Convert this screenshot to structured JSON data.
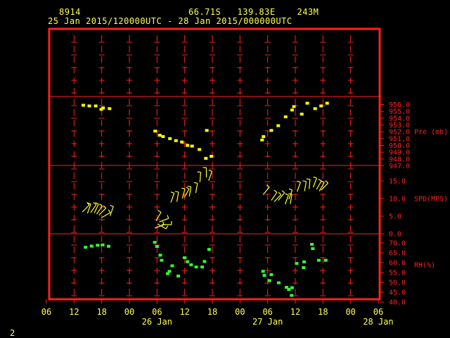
{
  "header": {
    "station": "8914",
    "location": "66.71S   139.83E    243M",
    "period": "25 Jan 2015/120000UTC - 28 Jan 2015/000000UTC"
  },
  "footer_number": "2",
  "colors": {
    "frame": "#ff2020",
    "text": "#ffff4d",
    "pressure": "#ffff00",
    "wind": "#ffff33",
    "rh": "#33ff33"
  },
  "chart_data": {
    "type": "scatter",
    "x_ticks": [
      "06",
      "12",
      "18",
      "00",
      "06",
      "12",
      "18",
      "00",
      "06",
      "12",
      "18",
      "00",
      "06"
    ],
    "date_labels": [
      {
        "label": "26 Jan",
        "hour_index": 4
      },
      {
        "label": "27 Jan",
        "hour_index": 8
      },
      {
        "label": "28 Jan",
        "hour_index": 12
      }
    ],
    "panels": [
      {
        "key": "pressure",
        "label": "Pre (mb)",
        "ticks": [
          "956.0",
          "955.0",
          "954.0",
          "953.0",
          "952.0",
          "951.0",
          "950.0",
          "949.0",
          "948.0",
          "947.0"
        ],
        "ylim": [
          947,
          956
        ],
        "points": [
          [
            14.0,
            955.9
          ],
          [
            15.3,
            955.8
          ],
          [
            16.7,
            955.8
          ],
          [
            17.9,
            955.3
          ],
          [
            18.3,
            955.5
          ],
          [
            19.7,
            955.4
          ],
          [
            29.6,
            952.1
          ],
          [
            30.6,
            951.5
          ],
          [
            31.3,
            951.3
          ],
          [
            32.8,
            951.0
          ],
          [
            34.1,
            950.7
          ],
          [
            35.4,
            950.5
          ],
          [
            36.6,
            950.0
          ],
          [
            37.6,
            949.9
          ],
          [
            39.2,
            949.4
          ],
          [
            40.6,
            948.1
          ],
          [
            40.8,
            952.2
          ],
          [
            41.8,
            948.4
          ],
          [
            52.8,
            950.8
          ],
          [
            53.1,
            951.3
          ],
          [
            54.8,
            952.2
          ],
          [
            56.3,
            952.9
          ],
          [
            57.9,
            954.2
          ],
          [
            59.3,
            955.2
          ],
          [
            59.7,
            955.7
          ],
          [
            61.4,
            954.6
          ],
          [
            62.6,
            956.2
          ],
          [
            64.3,
            955.4
          ],
          [
            65.6,
            955.8
          ],
          [
            66.9,
            956.2
          ]
        ]
      },
      {
        "key": "wind",
        "label": "SPD(MPS)",
        "ticks": [
          "15.0",
          "10.0",
          "5.0",
          "0.0"
        ],
        "ylim": [
          0,
          16
        ],
        "barbs": [
          [
            13.8,
            6.2,
            225
          ],
          [
            14.9,
            5.8,
            200
          ],
          [
            15.6,
            6.0,
            215
          ],
          [
            16.4,
            5.9,
            205
          ],
          [
            16.9,
            5.6,
            215
          ],
          [
            17.4,
            5.3,
            225
          ],
          [
            18.0,
            4.6,
            240
          ],
          [
            19.8,
            5.1,
            200
          ],
          [
            29.5,
            1.6,
            250
          ],
          [
            29.8,
            3.7,
            210
          ],
          [
            30.1,
            2.8,
            300
          ],
          [
            30.5,
            3.4,
            250
          ],
          [
            31.0,
            2.6,
            270
          ],
          [
            33.0,
            8.9,
            200
          ],
          [
            34.3,
            9.1,
            190
          ],
          [
            35.5,
            10.0,
            195
          ],
          [
            35.9,
            10.3,
            210
          ],
          [
            37.0,
            10.6,
            190
          ],
          [
            38.4,
            11.6,
            190
          ],
          [
            39.3,
            14.7,
            185
          ],
          [
            40.7,
            16.0,
            180
          ],
          [
            41.2,
            15.1,
            200
          ],
          [
            53.0,
            11.1,
            220
          ],
          [
            54.8,
            9.5,
            215
          ],
          [
            55.4,
            9.1,
            225
          ],
          [
            56.3,
            9.5,
            220
          ],
          [
            57.8,
            8.4,
            200
          ],
          [
            58.6,
            9.8,
            200
          ],
          [
            58.9,
            8.5,
            190
          ],
          [
            60.4,
            12.0,
            200
          ],
          [
            62.0,
            12.1,
            190
          ],
          [
            63.0,
            12.7,
            185
          ],
          [
            63.9,
            13.2,
            200
          ],
          [
            64.6,
            12.6,
            210
          ],
          [
            65.2,
            12.1,
            210
          ],
          [
            65.6,
            12.4,
            225
          ]
        ]
      },
      {
        "key": "rh",
        "label": "RH(%)",
        "ticks": [
          "70.0",
          "65.0",
          "60.0",
          "55.0",
          "50.0",
          "45.0",
          "40.0"
        ],
        "ylim": [
          40,
          70
        ],
        "points": [
          [
            14.5,
            67.8
          ],
          [
            15.8,
            68.4
          ],
          [
            17.1,
            68.8
          ],
          [
            18.2,
            69.0
          ],
          [
            19.5,
            68.3
          ],
          [
            29.5,
            70.3
          ],
          [
            30.0,
            68.2
          ],
          [
            30.7,
            63.8
          ],
          [
            31.0,
            61.2
          ],
          [
            32.3,
            54.4
          ],
          [
            32.7,
            55.6
          ],
          [
            33.3,
            58.4
          ],
          [
            34.6,
            53.2
          ],
          [
            36.0,
            62.5
          ],
          [
            36.6,
            60.5
          ],
          [
            37.4,
            58.9
          ],
          [
            38.5,
            57.8
          ],
          [
            39.8,
            57.8
          ],
          [
            40.3,
            60.6
          ],
          [
            41.3,
            66.7
          ],
          [
            53.0,
            55.6
          ],
          [
            53.3,
            53.5
          ],
          [
            54.4,
            50.9
          ],
          [
            54.8,
            53.9
          ],
          [
            56.4,
            49.8
          ],
          [
            58.1,
            47.5
          ],
          [
            58.6,
            46.4
          ],
          [
            59.2,
            43.4
          ],
          [
            59.3,
            47.3
          ],
          [
            60.3,
            59.6
          ],
          [
            61.8,
            57.5
          ],
          [
            61.9,
            60.4
          ],
          [
            63.6,
            69.3
          ],
          [
            63.8,
            67.1
          ],
          [
            65.1,
            61.2
          ],
          [
            66.6,
            61.2
          ]
        ]
      }
    ]
  }
}
